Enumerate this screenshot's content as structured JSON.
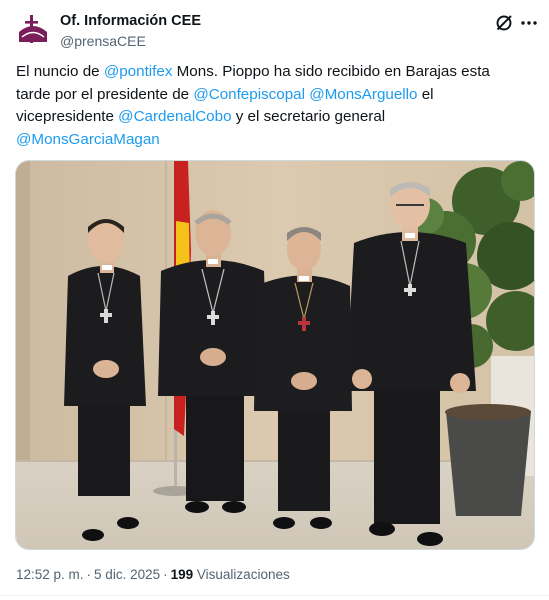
{
  "author": {
    "display_name": "Of. Información CEE",
    "handle": "@prensaCEE"
  },
  "tweet": {
    "segments": [
      {
        "text": "El nuncio de ",
        "mention": false
      },
      {
        "text": "@pontifex",
        "mention": true
      },
      {
        "text": " Mons. Pioppo ha sido recibido en Barajas esta tarde por el presidente de ",
        "mention": false
      },
      {
        "text": "@Confepiscopal",
        "mention": true
      },
      {
        "text": " ",
        "mention": false
      },
      {
        "text": "@MonsArguello",
        "mention": true
      },
      {
        "text": " el vicepresidente ",
        "mention": false
      },
      {
        "text": "@CardenalCobo",
        "mention": true
      },
      {
        "text": " y el secretario general ",
        "mention": false
      },
      {
        "text": "@MonsGarciaMagan",
        "mention": true
      }
    ]
  },
  "meta": {
    "time": "12:52 p. m.",
    "separator": "·",
    "date": "5 dic. 2025",
    "views_count": "199",
    "views_label": "Visualizaciones"
  },
  "icons": {
    "avatar": "cee-logo-icon",
    "grok": "grok-icon",
    "more": "more-icon"
  },
  "colors": {
    "accent": "#1d9bf0",
    "text": "#0f1419",
    "secondary": "#536471",
    "logo": "#7a1f5c"
  }
}
